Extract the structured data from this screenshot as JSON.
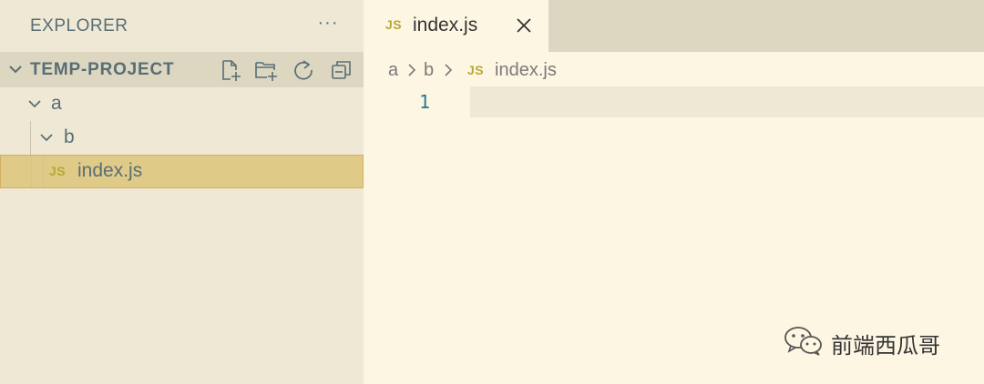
{
  "sidebar": {
    "title": "EXPLORER",
    "more_actions_label": "···",
    "project": {
      "name": "TEMP-PROJECT",
      "actions": [
        "new-file-icon",
        "new-folder-icon",
        "refresh-icon",
        "collapse-all-icon"
      ]
    },
    "tree": [
      {
        "label": "a",
        "type": "folder",
        "expanded": true
      },
      {
        "label": "b",
        "type": "folder",
        "expanded": true
      },
      {
        "label": "index.js",
        "type": "file",
        "badge": "JS",
        "selected": true
      }
    ]
  },
  "editor": {
    "tab": {
      "label": "index.js",
      "badge": "JS",
      "close_icon": "close-icon"
    },
    "breadcrumb": {
      "segments": [
        "a",
        "b"
      ],
      "file_badge": "JS",
      "file": "index.js"
    },
    "lines": [
      {
        "number": "1",
        "text": ""
      }
    ]
  },
  "watermark": {
    "text": "前端西瓜哥",
    "icon": "wechat-icon"
  },
  "colors": {
    "editor_bg": "#FDF6E3",
    "sidebar_bg": "#EEE8D5",
    "selection_bg": "#DFCA88",
    "js_badge": "#B8A833",
    "line_number": "#237893"
  }
}
